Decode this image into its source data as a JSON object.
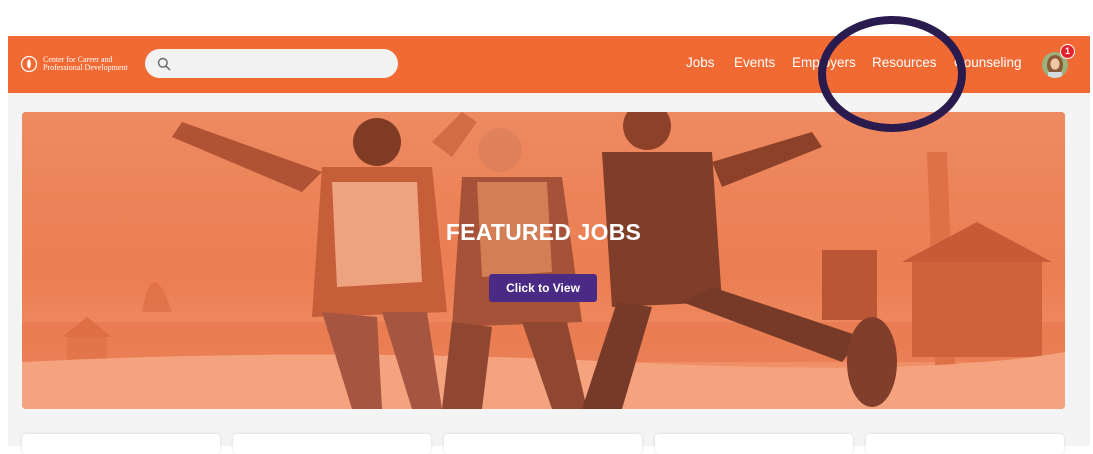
{
  "brand": {
    "name_line1": "Center for Career and",
    "name_line2": "Professional Development",
    "primary_color": "#f26a33",
    "accent_color": "#4b2a86",
    "logo_icon": "logo-mark-icon"
  },
  "search": {
    "placeholder": "",
    "value": "",
    "icon": "search-icon"
  },
  "nav": {
    "items": [
      {
        "label": "Jobs"
      },
      {
        "label": "Events"
      },
      {
        "label": "Employers"
      },
      {
        "label": "Resources"
      },
      {
        "label": "Counseling"
      }
    ]
  },
  "user": {
    "notification_count": "1",
    "avatar_icon": "user-avatar"
  },
  "hero": {
    "title": "FEATURED JOBS",
    "button_label": "Click to View"
  },
  "annotation": {
    "ring_color": "#2a1b4e"
  },
  "cards": {
    "count": 5
  }
}
